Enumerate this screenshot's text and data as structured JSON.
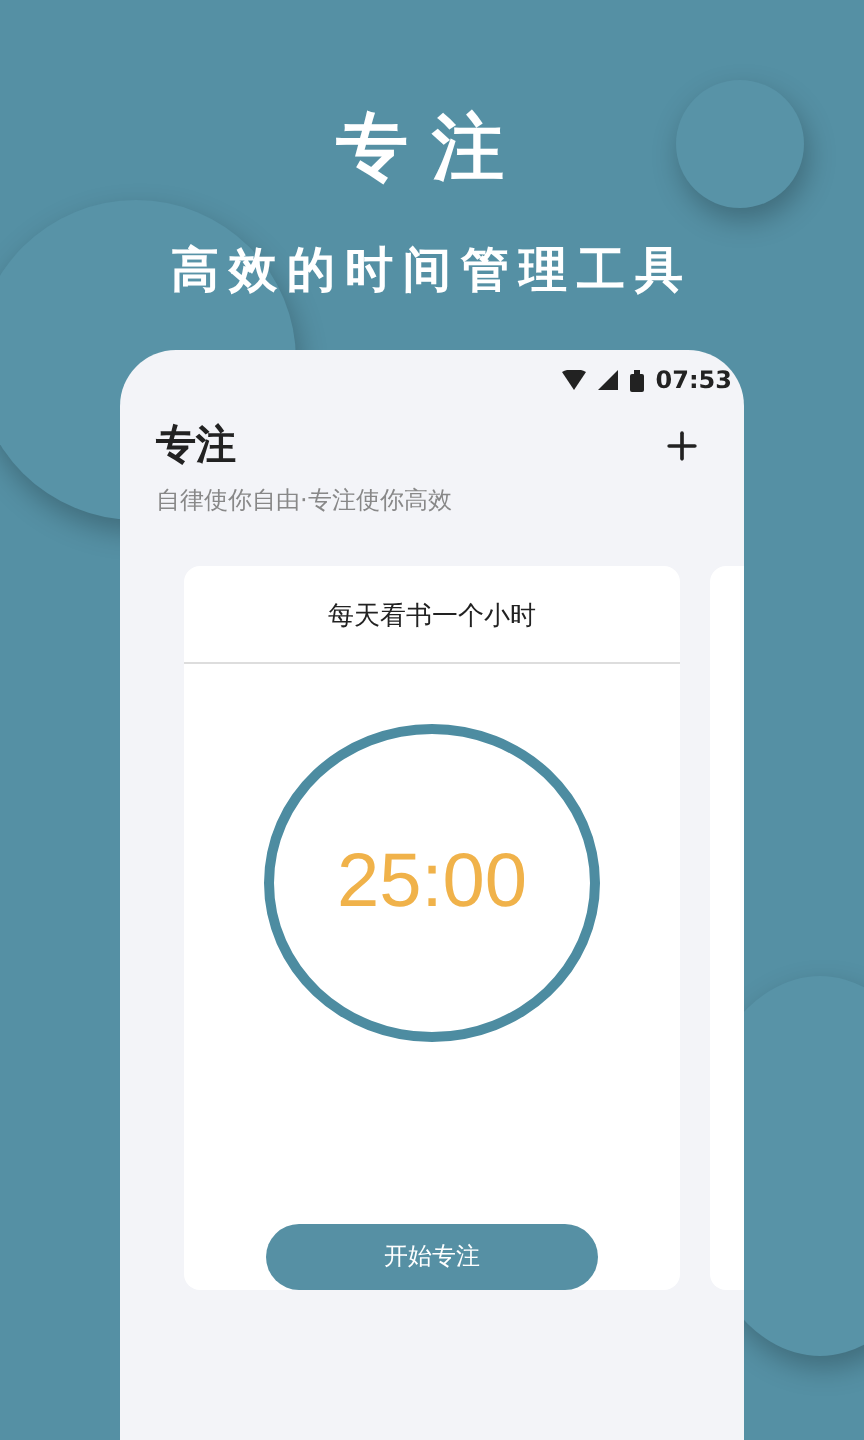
{
  "headline": "专注",
  "tagline": "高效的时间管理工具",
  "status_bar": {
    "time": "07:53"
  },
  "app_header": {
    "title": "专注",
    "subtitle": "自律使你自由·专注使你高效"
  },
  "cards": [
    {
      "title": "每天看书一个小时",
      "timer": "25:00",
      "button": "开始专注"
    }
  ]
}
